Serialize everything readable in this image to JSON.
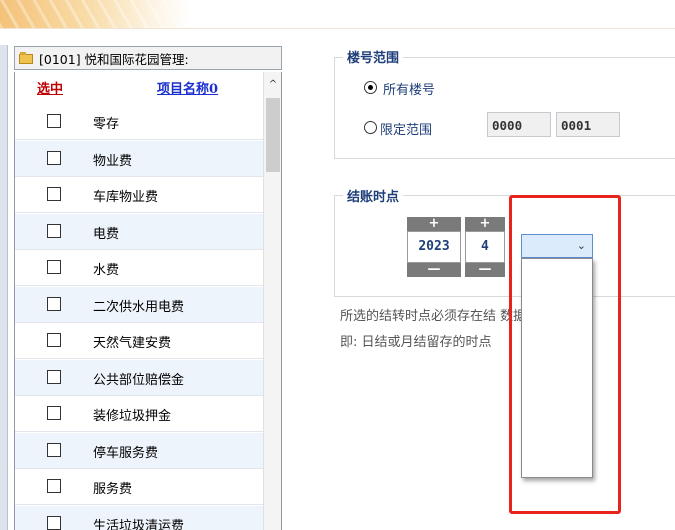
{
  "panel": {
    "title": "[0101] 悦和国际花园管理:",
    "header_select": "选中",
    "header_name": "项目名称0",
    "scroll_up": "^",
    "items": [
      {
        "label": "零存"
      },
      {
        "label": "物业费"
      },
      {
        "label": "车库物业费"
      },
      {
        "label": "电费"
      },
      {
        "label": "水费"
      },
      {
        "label": "二次供水用电费"
      },
      {
        "label": "天然气建安费"
      },
      {
        "label": "公共部位赔偿金"
      },
      {
        "label": "装修垃圾押金"
      },
      {
        "label": "停车服务费"
      },
      {
        "label": "服务费"
      },
      {
        "label": "生活垃圾清运费"
      }
    ]
  },
  "building_range": {
    "legend": "楼号范围",
    "option_all": "所有楼号",
    "option_limit": "限定范围",
    "from": "0000",
    "to": "0001",
    "selected": "all"
  },
  "closing_time": {
    "legend": "结账时点",
    "plus": "+",
    "minus": "—",
    "year": "2023",
    "month": "4",
    "day_selected": "",
    "chevron": "⌄",
    "note_line1": "所选的结转时点必须存在结           数据，",
    "note_line2": "即: 日结或月结留存的时点"
  },
  "colors": {
    "highlight": "#e8231b",
    "select_bg": "#dcebfb",
    "header_select_color": "#c00000",
    "header_name_color": "#1a2fd0"
  }
}
